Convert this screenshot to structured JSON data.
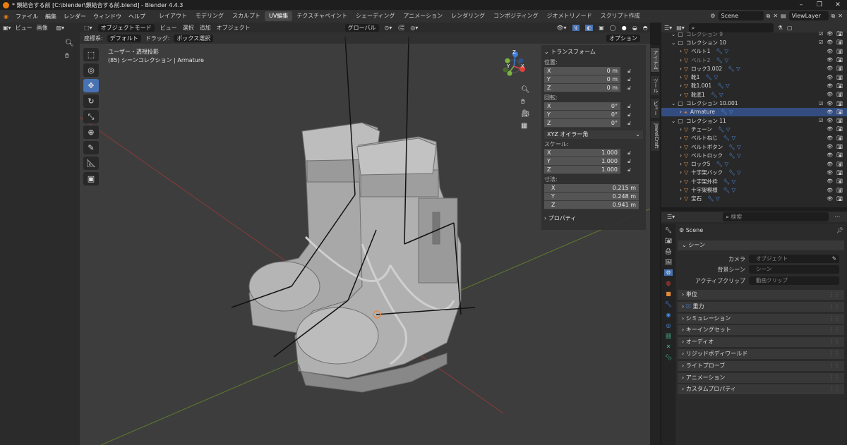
{
  "window": {
    "title": "* 鎖結合する前 [C:\\blender\\鎖結合する前.blend] - Blender 4.4.3",
    "controls": [
      "–",
      "❐",
      "✕"
    ]
  },
  "menu": {
    "items": [
      "ファイル",
      "編集",
      "レンダー",
      "ウィンドウ",
      "ヘルプ"
    ],
    "workspaces": [
      "レイアウト",
      "モデリング",
      "スカルプト",
      "UV編集",
      "テクスチャペイント",
      "シェーディング",
      "アニメーション",
      "レンダリング",
      "コンポジティング",
      "ジオメトリノード",
      "スクリプト作成"
    ],
    "active_workspace": "UV編集",
    "scene": "Scene",
    "view_layer": "ViewLayer"
  },
  "left_header": {
    "view": "ビュー",
    "image": "画像"
  },
  "viewport": {
    "mode": "オブジェクトモード",
    "menus": [
      "ビュー",
      "選択",
      "追加",
      "オブジェクト"
    ],
    "orientation": "グローバル",
    "coord_label": "座標系:",
    "coord_value": "デフォルト",
    "drag_label": "ドラッグ:",
    "drag_value": "ボックス選択",
    "options": "オプション",
    "overlay_line1": "ユーザー・透視投影",
    "overlay_line2": "(85) シーンコレクション | Armature",
    "gizmo": {
      "x": "X",
      "y": "Y",
      "z": "Z"
    }
  },
  "npanel": {
    "section_transform": "トランスフォーム",
    "location_label": "位置:",
    "location": [
      {
        "axis": "X",
        "value": "0 m"
      },
      {
        "axis": "Y",
        "value": "0 m"
      },
      {
        "axis": "Z",
        "value": "0 m"
      }
    ],
    "rotation_label": "回転:",
    "rotation": [
      {
        "axis": "X",
        "value": "0°"
      },
      {
        "axis": "Y",
        "value": "0°"
      },
      {
        "axis": "Z",
        "value": "0°"
      }
    ],
    "rotation_mode": "XYZ オイラー角",
    "scale_label": "スケール:",
    "scale": [
      {
        "axis": "X",
        "value": "1.000"
      },
      {
        "axis": "Y",
        "value": "1.000"
      },
      {
        "axis": "Z",
        "value": "1.000"
      }
    ],
    "dimensions_label": "寸法:",
    "dimensions": [
      {
        "axis": "X",
        "value": "0.215 m"
      },
      {
        "axis": "Y",
        "value": "0.248 m"
      },
      {
        "axis": "Z",
        "value": "0.941 m"
      }
    ],
    "section_properties": "プロパティ",
    "tabs": [
      "アイテム",
      "ツール",
      "ビュー",
      "JewelCraft"
    ]
  },
  "outliner": {
    "rows": [
      {
        "label": "コレクション 9",
        "kind": "collection",
        "dim": true
      },
      {
        "label": "コレクション 10",
        "kind": "collection"
      },
      {
        "label": "ベルト1",
        "kind": "object"
      },
      {
        "label": "ベルト2",
        "kind": "object",
        "dim": true
      },
      {
        "label": "ロック3.002",
        "kind": "object"
      },
      {
        "label": "靴1",
        "kind": "object"
      },
      {
        "label": "靴1.001",
        "kind": "object"
      },
      {
        "label": "靴底1",
        "kind": "object"
      },
      {
        "label": "コレクション 10.001",
        "kind": "collection"
      },
      {
        "label": "Armature",
        "kind": "armature",
        "selected": true
      },
      {
        "label": "コレクション 11",
        "kind": "collection"
      },
      {
        "label": "チェーン",
        "kind": "object"
      },
      {
        "label": "ベルトねじ",
        "kind": "object"
      },
      {
        "label": "ベルトボタン",
        "kind": "object"
      },
      {
        "label": "ベルトロック",
        "kind": "object"
      },
      {
        "label": "ロック5",
        "kind": "object"
      },
      {
        "label": "十字架バック",
        "kind": "object"
      },
      {
        "label": "十字架外枠",
        "kind": "object"
      },
      {
        "label": "十字架模様",
        "kind": "object"
      },
      {
        "label": "宝石",
        "kind": "object"
      }
    ]
  },
  "properties": {
    "search_placeholder": "検索",
    "context": "Scene",
    "scene_section": "シーン",
    "camera_label": "カメラ",
    "camera_value": "オブジェクト",
    "bg_label": "背景シーン",
    "bg_value": "シーン",
    "clip_label": "アクティブクリップ",
    "clip_value": "動画クリップ",
    "sections": [
      "単位",
      "重力",
      "シミュレーション",
      "キーイングセット",
      "オーディオ",
      "リジッドボディワールド",
      "ライトプローブ",
      "アニメーション",
      "カスタムプロパティ"
    ]
  },
  "colors": {
    "accent": "#4772b3",
    "selected_row": "#334d80",
    "object_icon": "#e08a3c"
  }
}
